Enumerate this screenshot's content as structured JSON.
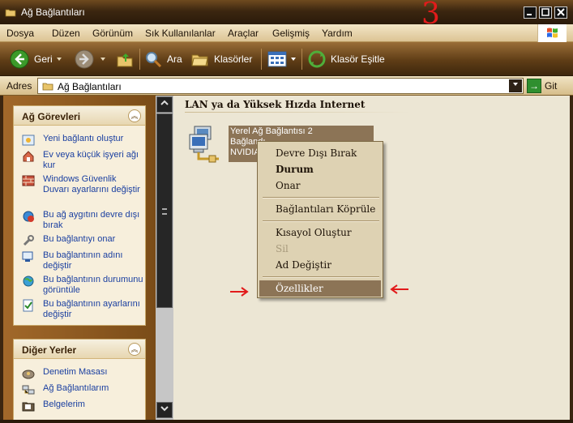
{
  "window": {
    "title": "Ağ Bağlantıları",
    "annotation_number": "3",
    "controls": [
      "minimize",
      "maximize",
      "close"
    ]
  },
  "menu": {
    "items": [
      "Dosya",
      "Düzen",
      "Görünüm",
      "Sık Kullanılanlar",
      "Araçlar",
      "Gelişmiş",
      "Yardım"
    ]
  },
  "toolbar": {
    "back_label": "Geri",
    "search_label": "Ara",
    "folders_label": "Klasörler",
    "sync_label": "Klasör Eşitle"
  },
  "address": {
    "label": "Adres",
    "value": "Ağ Bağlantıları",
    "go_label": "Git"
  },
  "left_pane": {
    "tasks": {
      "title": "Ağ Görevleri",
      "items": [
        "Yeni bağlantı oluştur",
        "Ev veya küçük işyeri ağı kur",
        "Windows Güvenlik Duvarı ayarlarını değiştir",
        "Bu ağ aygıtını devre dışı bırak",
        "Bu bağlantıyı onar",
        "Bu bağlantının adını değiştir",
        "Bu bağlantının durumunu görüntüle",
        "Bu bağlantının ayarlarını değiştir"
      ]
    },
    "other_places": {
      "title": "Diğer Yerler",
      "items": [
        "Denetim Masası",
        "Ağ Bağlantılarım",
        "Belgelerim"
      ]
    }
  },
  "content": {
    "group_header": "LAN ya da Yüksek Hızda Internet",
    "connection": {
      "name": "Yerel Ağ Bağlantısı 2",
      "status": "Bağlandı",
      "adapter": "NVIDIA"
    }
  },
  "context_menu": {
    "items": [
      {
        "label": "Devre Dışı Bırak",
        "style": "normal"
      },
      {
        "label": "Durum",
        "style": "bold"
      },
      {
        "label": "Onar",
        "style": "normal"
      },
      {
        "label": "Bağlantıları Köprüle",
        "style": "normal"
      },
      {
        "label": "Kısayol Oluştur",
        "style": "normal"
      },
      {
        "label": "Sil",
        "style": "disabled"
      },
      {
        "label": "Ad Değiştir",
        "style": "normal"
      },
      {
        "label": "Özellikler",
        "style": "highlighted"
      }
    ]
  },
  "colors": {
    "accent_brown": "#8c7456",
    "link_blue": "#1a3fa0",
    "annotation_red": "#e21b1b"
  }
}
